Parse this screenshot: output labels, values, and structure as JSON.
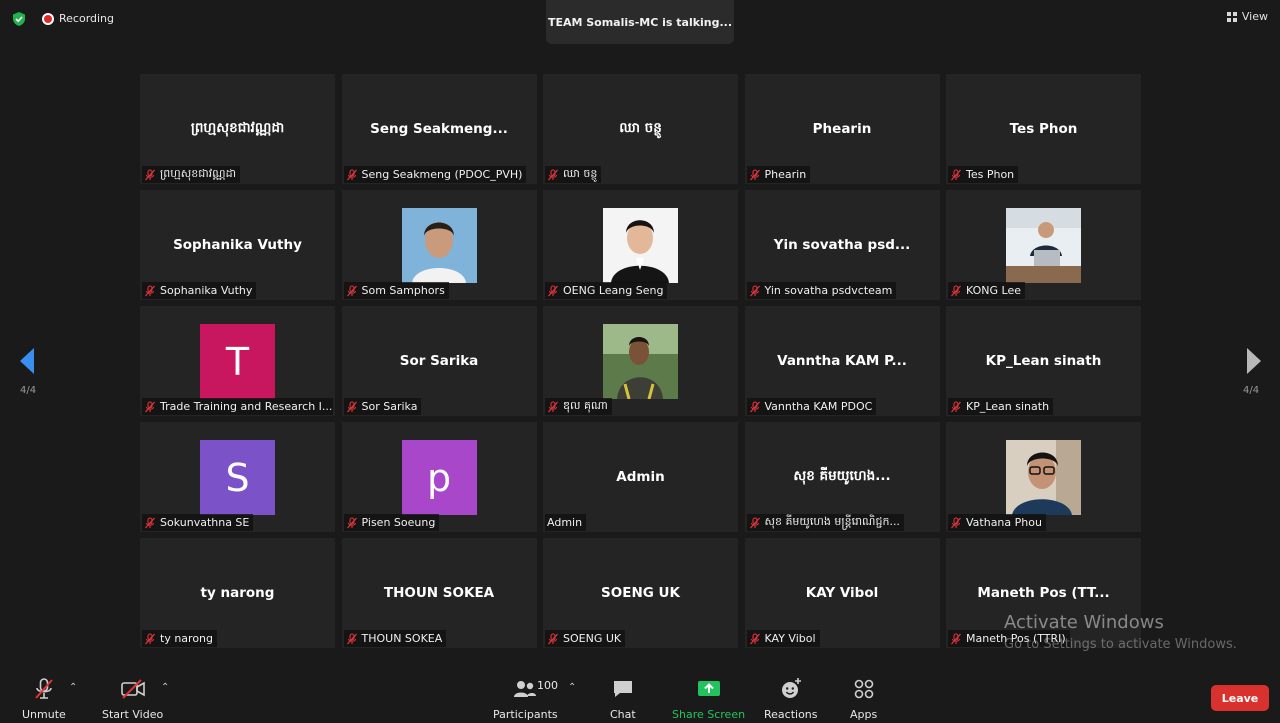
{
  "topbar": {
    "recording_label": "Recording",
    "talking_text": "TEAM Somalis-MC is talking...",
    "view_label": "View"
  },
  "pagination": {
    "left": "4/4",
    "right": "4/4"
  },
  "participants": [
    {
      "big": "ព្រហ្មសុខជាវណ្ណដា",
      "plate": "ព្រហ្មសុខជាវណ្ណដា",
      "kind": "name"
    },
    {
      "big": "Seng  Seakmeng...",
      "plate": "Seng Seakmeng (PDOC_PVH)",
      "kind": "name"
    },
    {
      "big": "ឈា ចន្ថូ",
      "plate": "ឈា ចន្ថូ",
      "kind": "name"
    },
    {
      "big": "Phearin",
      "plate": "Phearin",
      "kind": "name"
    },
    {
      "big": "Tes Phon",
      "plate": "Tes Phon",
      "kind": "name"
    },
    {
      "big": "Sophanika Vuthy",
      "plate": "Sophanika Vuthy",
      "kind": "name"
    },
    {
      "big": "",
      "plate": "Som Samphors",
      "kind": "photo",
      "photo": "woman"
    },
    {
      "big": "",
      "plate": "OENG Leang Seng",
      "kind": "photo",
      "photo": "man"
    },
    {
      "big": "Yin sovatha psd...",
      "plate": "Yin sovatha psdvcteam",
      "kind": "name"
    },
    {
      "big": "",
      "plate": "KONG Lee",
      "kind": "photo",
      "photo": "desk"
    },
    {
      "big": "T",
      "plate": "Trade Training and Research I...",
      "kind": "letter",
      "color": "#c8175e"
    },
    {
      "big": "Sor Sarika",
      "plate": "Sor Sarika",
      "kind": "name"
    },
    {
      "big": "",
      "plate": "ឌុល គុណា",
      "kind": "photo",
      "photo": "outdoor"
    },
    {
      "big": "Vanntha KAM P...",
      "plate": "Vanntha KAM PDOC",
      "kind": "name"
    },
    {
      "big": "KP_Lean sinath",
      "plate": "KP_Lean sinath",
      "kind": "name"
    },
    {
      "big": "S",
      "plate": "Sokunvathna SE",
      "kind": "letter",
      "color": "#7b52c8"
    },
    {
      "big": "p",
      "plate": "Pisen Soeung",
      "kind": "letter",
      "color": "#a847c9"
    },
    {
      "big": "Admin",
      "plate": "Admin",
      "kind": "name",
      "unmuted": true
    },
    {
      "big": "សុខ គីមយូហេង...",
      "plate": "សុខ គីមយូហេង មន្ត្រីរោណិជ្ជក...",
      "kind": "name"
    },
    {
      "big": "",
      "plate": "Vathana Phou",
      "kind": "photo",
      "photo": "glasses"
    },
    {
      "big": "ty narong",
      "plate": "ty narong",
      "kind": "name"
    },
    {
      "big": "THOUN SOKEA",
      "plate": "THOUN SOKEA",
      "kind": "name"
    },
    {
      "big": "SOENG UK",
      "plate": "SOENG UK",
      "kind": "name"
    },
    {
      "big": "KAY Vibol",
      "plate": "KAY Vibol",
      "kind": "name"
    },
    {
      "big": "Maneth Pos  (TT...",
      "plate": "Maneth Pos (TTRI)",
      "kind": "name"
    }
  ],
  "watermark": {
    "title": "Activate Windows",
    "subtitle": "Go to Settings to activate Windows."
  },
  "toolbar": {
    "unmute": "Unmute",
    "start_video": "Start Video",
    "participants_count": "100",
    "participants": "Participants",
    "chat": "Chat",
    "share_screen": "Share Screen",
    "reactions": "Reactions",
    "apps": "Apps",
    "leave": "Leave"
  },
  "colors": {
    "accent_green": "#22c35e",
    "leave_red": "#d9322e",
    "muted_red": "#e0353a"
  }
}
